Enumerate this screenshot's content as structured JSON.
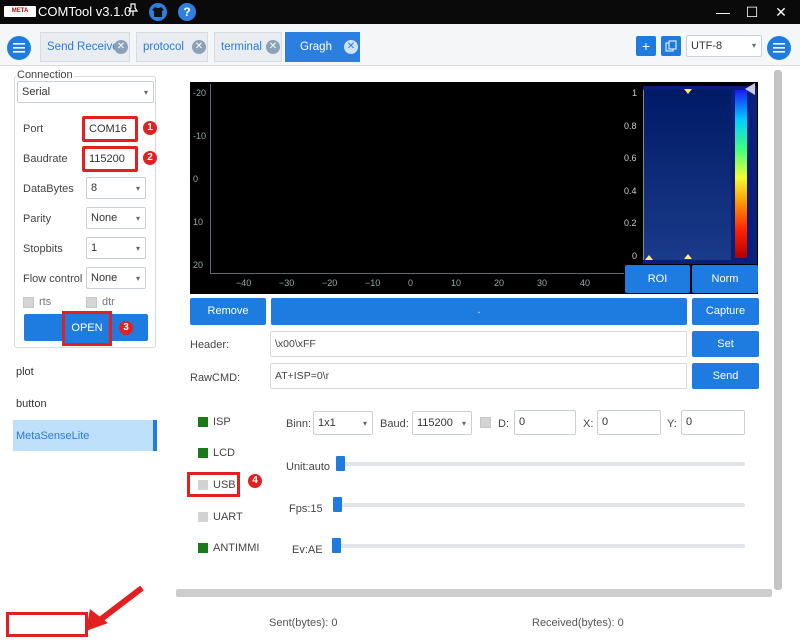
{
  "window": {
    "logo_text": "META SENSE",
    "title": "COMTool v3.1.0",
    "minimize": "—",
    "maximize": "☐",
    "close": "✕"
  },
  "titlebar_icons": {
    "pin": "📌",
    "shirt": "👕",
    "help": "?"
  },
  "tabs": [
    {
      "label": "Send Receive"
    },
    {
      "label": "protocol"
    },
    {
      "label": "terminal"
    },
    {
      "label": "Gragh"
    }
  ],
  "toolbar": {
    "add": "+",
    "encoding": "UTF-8"
  },
  "connection": {
    "group_title": "Connection",
    "type": "Serial",
    "port_label": "Port",
    "port_value": "COM16",
    "baud_label": "Baudrate",
    "baud_value": "115200",
    "databytes_label": "DataBytes",
    "databytes_value": "8",
    "parity_label": "Parity",
    "parity_value": "None",
    "stopbits_label": "Stopbits",
    "stopbits_value": "1",
    "flow_label": "Flow control",
    "flow_value": "None",
    "rts_label": "rts",
    "dtr_label": "dtr",
    "open_label": "OPEN"
  },
  "annotations": {
    "b1": "1",
    "b2": "2",
    "b3": "3",
    "b4": "4"
  },
  "nav": {
    "plot": "plot",
    "button": "button",
    "metasense": "MetaSenseLite"
  },
  "plot": {
    "y_ticks": [
      "-20",
      "-10",
      "0",
      "10",
      "20"
    ],
    "x_ticks": [
      "−40",
      "−30",
      "−20",
      "−10",
      "0",
      "10",
      "20",
      "30",
      "40"
    ],
    "cbar_ticks": [
      "1",
      "0.8",
      "0.6",
      "0.4",
      "0.2",
      "0"
    ],
    "roi": "ROI",
    "norm": "Norm"
  },
  "actions": {
    "remove": "Remove",
    "center": ".",
    "capture": "Capture",
    "set": "Set",
    "send": "Send"
  },
  "form": {
    "header_label": "Header:",
    "header_value": "\\x00\\xFF",
    "rawcmd_label": "RawCMD:",
    "rawcmd_value": "AT+ISP=0\\r"
  },
  "status": {
    "isp": "ISP",
    "lcd": "LCD",
    "usb": "USB",
    "uart": "UART",
    "antimmi": "ANTIMMI",
    "on_color": "#1a7a1a",
    "off_color": "#d2d2d2"
  },
  "controls": {
    "binn_label": "Binn:",
    "binn_value": "1x1",
    "baud_label": "Baud:",
    "baud_value": "115200",
    "d_label": "D:",
    "d_value": "0",
    "x_label": "X:",
    "x_value": "0",
    "y_label": "Y:",
    "y_value": "0",
    "unit_label": "Unit:auto",
    "fps_label": "Fps:15",
    "ev_label": "Ev:AE"
  },
  "footer": {
    "sent": "Sent(bytes): 0",
    "received": "Received(bytes): 0"
  },
  "colors": {
    "accent": "#1e7be0",
    "highlight": "#e32020",
    "plot_bg": "#000000"
  }
}
